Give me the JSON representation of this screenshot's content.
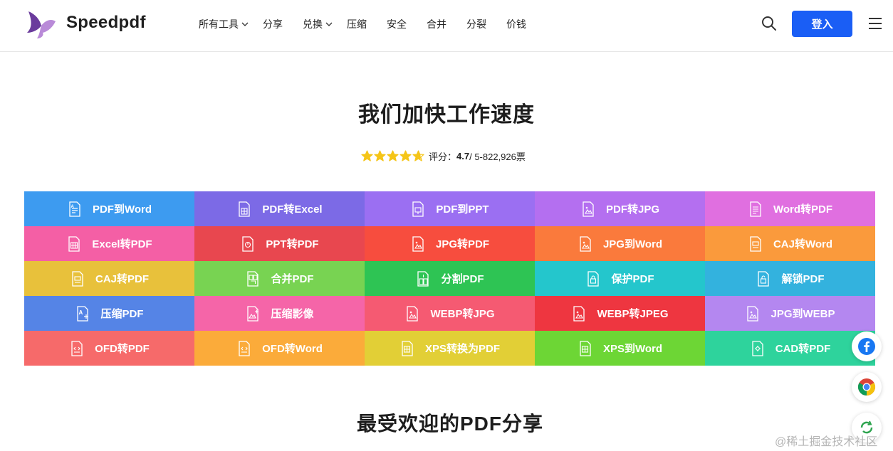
{
  "header": {
    "brand": "Speedpdf",
    "nav": [
      "所有工具",
      "分享",
      "兑换",
      "压缩",
      "安全",
      "合并",
      "分裂",
      "价钱"
    ],
    "login_label": "登入",
    "logo_colors": {
      "primary": "#6a3b9c",
      "secondary": "#b98ad8"
    }
  },
  "hero": {
    "title": "我们加快工作速度",
    "rating_prefix": "评分：",
    "rating_score": "4.7",
    "rating_suffix": " / 5-822,926票",
    "star_value": 4.7,
    "star_color": "#f5c518"
  },
  "tools": [
    {
      "label": "PDF到Word",
      "color": "#3d9bf0",
      "icon": "document-text-icon"
    },
    {
      "label": "PDF转Excel",
      "color": "#7c6ae6",
      "icon": "spreadsheet-icon"
    },
    {
      "label": "PDF到PPT",
      "color": "#9b6ff2",
      "icon": "presentation-icon"
    },
    {
      "label": "PDF转JPG",
      "color": "#b46ff0",
      "icon": "image-icon"
    },
    {
      "label": "Word转PDF",
      "color": "#e06fe0",
      "icon": "document-lines-icon"
    },
    {
      "label": "Excel转PDF",
      "color": "#f45fa5",
      "icon": "table-icon"
    },
    {
      "label": "PPT转PDF",
      "color": "#e8474f",
      "icon": "chart-icon"
    },
    {
      "label": "JPG转PDF",
      "color": "#f74d3e",
      "icon": "image-icon"
    },
    {
      "label": "JPG到Word",
      "color": "#fa7a3c",
      "icon": "image-icon"
    },
    {
      "label": "CAJ转Word",
      "color": "#fa9a3c",
      "icon": "document-icon"
    },
    {
      "label": "CAJ转PDF",
      "color": "#e8c13b",
      "icon": "document-icon"
    },
    {
      "label": "合并PDF",
      "color": "#78d352",
      "icon": "merge-icon"
    },
    {
      "label": "分割PDF",
      "color": "#2ec454",
      "icon": "split-icon"
    },
    {
      "label": "保护PDF",
      "color": "#24c6cc",
      "icon": "lock-icon"
    },
    {
      "label": "解锁PDF",
      "color": "#33b2de",
      "icon": "unlock-icon"
    },
    {
      "label": "压缩PDF",
      "color": "#5584e6",
      "icon": "compress-icon"
    },
    {
      "label": "压缩影像",
      "color": "#f565a8",
      "icon": "image-compress-icon"
    },
    {
      "label": "WEBP转JPG",
      "color": "#f55a72",
      "icon": "image-icon"
    },
    {
      "label": "WEBP转JPEG",
      "color": "#ee3640",
      "icon": "image-icon"
    },
    {
      "label": "JPG到WEBP",
      "color": "#b487f0",
      "icon": "image-icon"
    },
    {
      "label": "OFD转PDF",
      "color": "#f66a6a",
      "icon": "code-doc-icon"
    },
    {
      "label": "OFD转Word",
      "color": "#fbab3a",
      "icon": "code-doc-icon"
    },
    {
      "label": "XPS转换为PDF",
      "color": "#e2cf36",
      "icon": "grid-doc-icon"
    },
    {
      "label": "XPS到Word",
      "color": "#6dd635",
      "icon": "grid-doc-icon"
    },
    {
      "label": "CAD转PDF",
      "color": "#2ed39c",
      "icon": "gear-doc-icon"
    }
  ],
  "section": {
    "title": "最受欢迎的PDF分享"
  },
  "watermark": "@稀土掘金技术社区"
}
